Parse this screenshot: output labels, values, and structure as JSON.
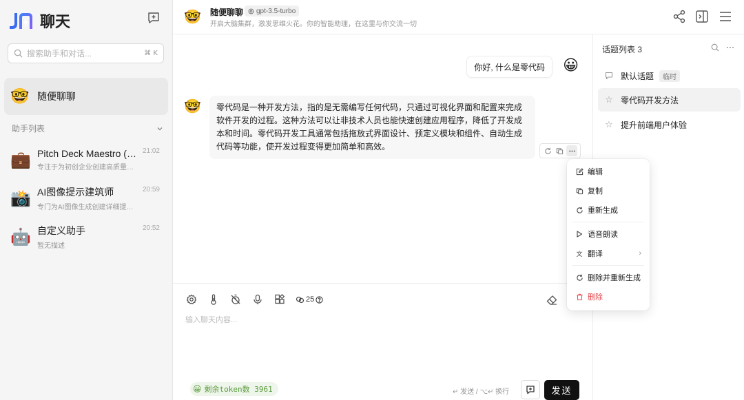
{
  "sidebar": {
    "brand_title": "聊天",
    "search_placeholder": "搜索助手和对话...",
    "search_shortcut": "⌘ K",
    "active_agent": {
      "emoji": "🤓",
      "name": "随便聊聊"
    },
    "section_label": "助手列表",
    "agents": [
      {
        "emoji": "💼",
        "title": "Pitch Deck Maestro (El...",
        "desc": "专注于为初创企业创建高质量的...",
        "time": "21:02"
      },
      {
        "emoji": "📸",
        "title": "AI图像提示建筑师",
        "desc": "专门为AI图像生成创建详细提示。",
        "time": "20:59"
      },
      {
        "emoji": "🤖",
        "title": "自定义助手",
        "desc": "暂无描述",
        "time": "20:52"
      }
    ]
  },
  "header": {
    "avatar": "🤓",
    "name": "随便聊聊",
    "model": "gpt-3.5-turbo",
    "description": "开启大脑集群，激发思维火花。你的智能助理，在这里与你交流一切"
  },
  "chat": {
    "user_message": "你好, 什么是零代码",
    "user_avatar": "😀",
    "bot_avatar": "🤓",
    "bot_message": "零代码是一种开发方法，指的是无需编写任何代码，只通过可视化界面和配置来完成软件开发的过程。这种方法可以让非技术人员也能快速创建应用程序，降低了开发成本和时间。零代码开发工具通常包括拖放式界面设计、预定义模块和组件、自动生成代码等功能，使开发过程变得更加简单和高效。"
  },
  "input": {
    "token_value": "25",
    "placeholder": "输入聊天内容...",
    "token_left_emoji": "😀",
    "token_left": "剩余token数 3961",
    "send_hint": "↵ 发送 / ⌥↵ 换行",
    "send_label": "发送"
  },
  "topics": {
    "header": "话题列表 3",
    "items": [
      {
        "label": "默认话题",
        "tag": "临时"
      },
      {
        "label": "零代码开发方法"
      },
      {
        "label": "提升前端用户体验"
      }
    ]
  },
  "context_menu": {
    "edit": "编辑",
    "copy": "复制",
    "regenerate": "重新生成",
    "tts": "语音朗读",
    "translate": "翻译",
    "delete_regenerate": "删除并重新生成",
    "delete": "删除"
  },
  "colors": {
    "danger": "#e5484d",
    "send_button": "#111111",
    "token_green": "#5a9a3c"
  }
}
